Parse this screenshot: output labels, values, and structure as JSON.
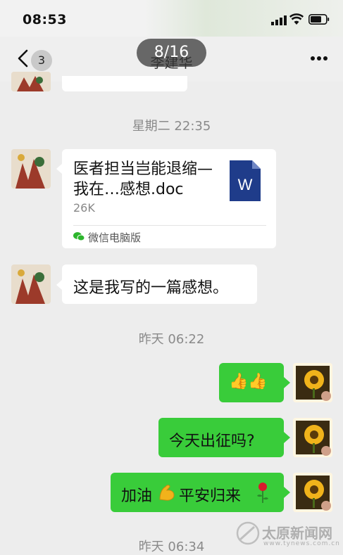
{
  "status_bar": {
    "time": "08:53"
  },
  "header": {
    "back_count": "3",
    "title": "李建华",
    "pager": "8/16"
  },
  "messages": {
    "ts1": "星期二 22:35",
    "file": {
      "name": "医者担当岂能退缩—我在…感想.doc",
      "size": "26K",
      "source": "微信电脑版",
      "type_letter": "W"
    },
    "text1": "这是我写的一篇感想。",
    "ts2": "昨天 06:22",
    "sent1": "👍👍",
    "sent2": "今天出征吗?",
    "sent3_a": "加油",
    "sent3_b": "平安归来",
    "ts3": "昨天 06:34"
  },
  "watermark": {
    "name": "太原新闻网",
    "url": "www.tynews.com.cn"
  },
  "colors": {
    "sent_bubble": "#39cc3a",
    "received_bubble": "#ffffff",
    "background": "#ededed",
    "word_icon": "#1f3c8a"
  }
}
